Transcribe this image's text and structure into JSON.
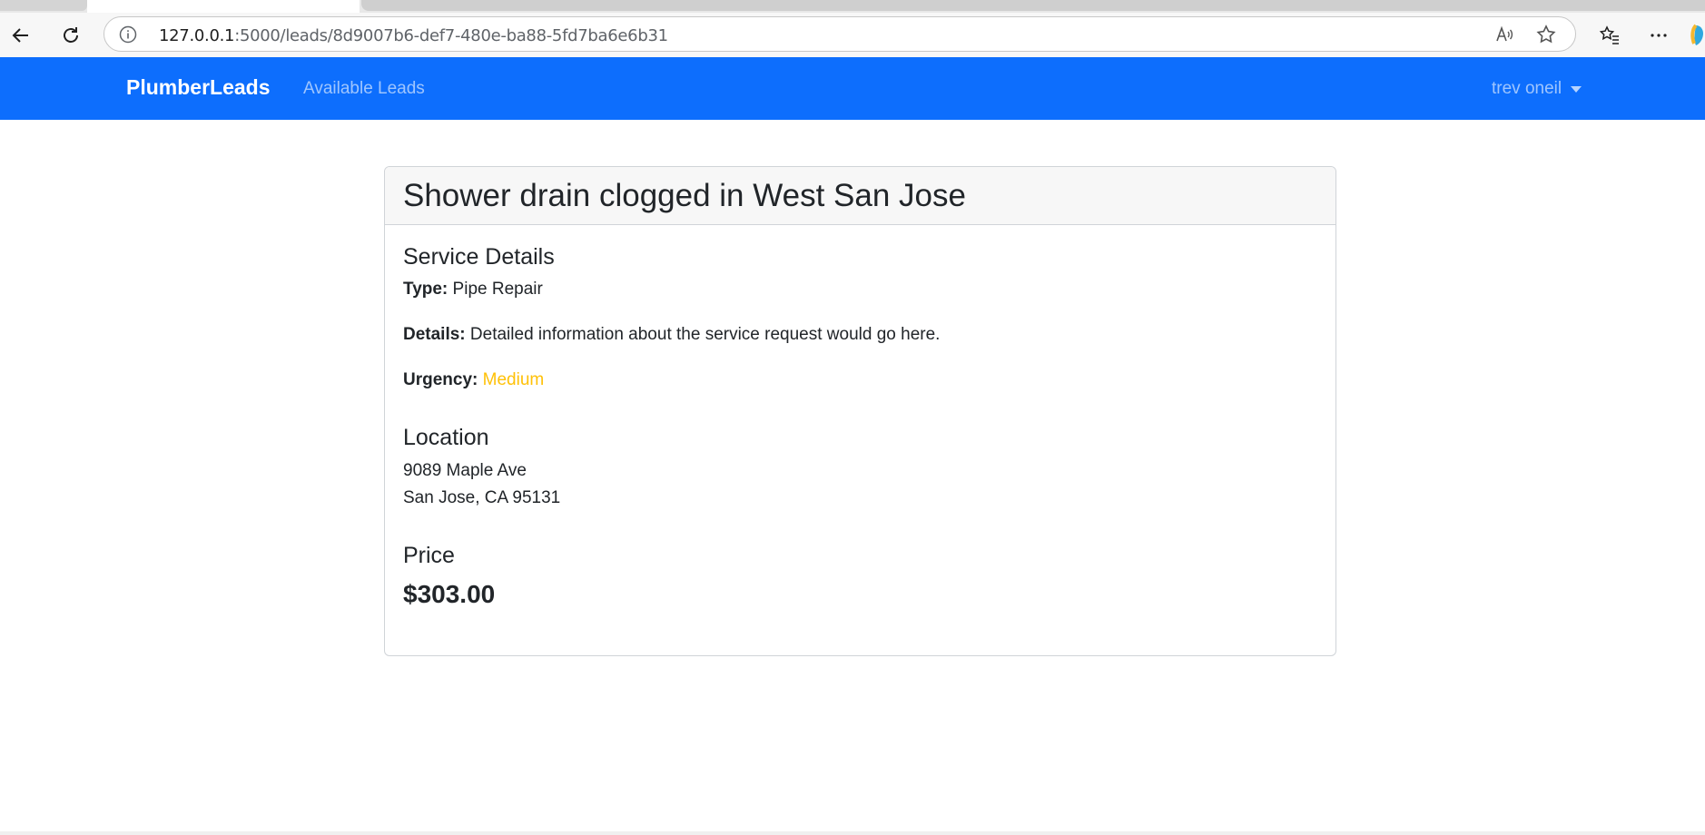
{
  "browser": {
    "url_host": "127.0.0.1",
    "url_path": ":5000/leads/8d9007b6-def7-480e-ba88-5fd7ba6e6b31"
  },
  "navbar": {
    "brand": "PlumberLeads",
    "links": [
      "Available Leads"
    ],
    "user": "trev oneil",
    "color": "#0d6efd"
  },
  "lead": {
    "title": "Shower drain clogged in West San Jose",
    "service_heading": "Service Details",
    "type_label": "Type:",
    "type_value": "Pipe Repair",
    "details_label": "Details:",
    "details_value": "Detailed information about the service request would go here.",
    "urgency_label": "Urgency:",
    "urgency_value": "Medium",
    "urgency_color": "#ffc107",
    "location_heading": "Location",
    "address_line1": "9089 Maple Ave",
    "address_line2": "San Jose, CA 95131",
    "price_heading": "Price",
    "price_value": "$303.00"
  }
}
